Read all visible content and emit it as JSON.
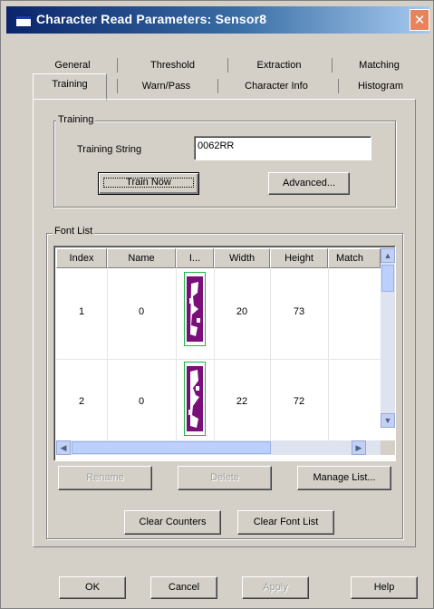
{
  "window": {
    "title": "Character Read Parameters: Sensor8",
    "close_glyph": "✕"
  },
  "tabs_row1": [
    "General",
    "Threshold",
    "Extraction",
    "Matching"
  ],
  "tabs_row2": [
    "Training",
    "Warn/Pass",
    "Character Info",
    "Histogram"
  ],
  "training": {
    "group_label": "Training",
    "string_label": "Training String",
    "string_value": "0062RR",
    "train_now": "Train Now",
    "advanced": "Advanced..."
  },
  "font_list": {
    "group_label": "Font List",
    "columns": [
      "Index",
      "Name",
      "I...",
      "Width",
      "Height",
      "Match"
    ],
    "rows": [
      {
        "index": "1",
        "name": "0",
        "width": "20",
        "height": "73",
        "match": ""
      },
      {
        "index": "2",
        "name": "0",
        "width": "22",
        "height": "72",
        "match": ""
      }
    ],
    "rename": "Rename",
    "delete": "Delete",
    "manage": "Manage List...",
    "clear_counters": "Clear Counters",
    "clear_font_list": "Clear Font List"
  },
  "footer": {
    "ok": "OK",
    "cancel": "Cancel",
    "apply": "Apply",
    "help": "Help"
  },
  "colors": {
    "title_start": "#0a246a",
    "title_end": "#a6caf0",
    "glyph": "#7a0f7a",
    "glyph_border": "#22b14c",
    "close": "#e8845c"
  }
}
